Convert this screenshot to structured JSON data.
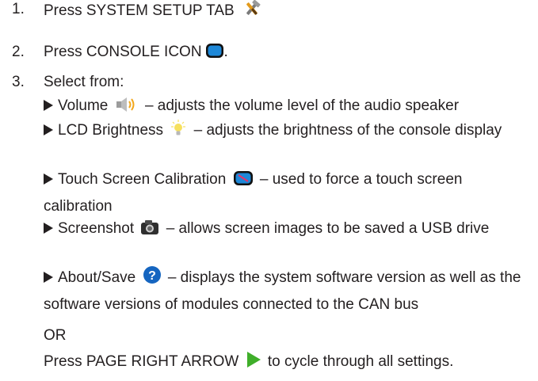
{
  "steps": [
    {
      "number": "1.",
      "text": "Press SYSTEM SETUP TAB",
      "icon": "tools-icon"
    },
    {
      "number": "2.",
      "text": "Press CONSOLE ICON",
      "icon": "console-icon",
      "trail": "."
    },
    {
      "number": "3.",
      "text": "Select from:"
    }
  ],
  "options": [
    {
      "label": "Volume",
      "icon": "speaker-icon",
      "desc": "– adjusts the volume level of the audio speaker"
    },
    {
      "label": "LCD Brightness",
      "icon": "lightbulb-icon",
      "desc": "– adjusts the brightness of the console display"
    },
    {
      "label": "Touch Screen Calibration",
      "icon": "calibration-icon",
      "desc": "– used to force a touch screen calibration"
    },
    {
      "label": "Screenshot",
      "icon": "camera-icon",
      "desc": "– allows screen images to be saved a USB drive"
    },
    {
      "label": "About/Save",
      "icon": "help-icon",
      "desc": "– displays the system software version as well as the software versions of modules connected to the CAN bus"
    }
  ],
  "or_text": "OR",
  "final": {
    "before": "Press PAGE RIGHT ARROW",
    "icon": "right-arrow-icon",
    "after": "to cycle through all settings."
  },
  "colors": {
    "text": "#231f20",
    "console_blue": "#1e88d8",
    "arrow_green": "#3fae2a",
    "help_blue": "#1565c0",
    "bulb_yellow": "#f6e05e"
  }
}
